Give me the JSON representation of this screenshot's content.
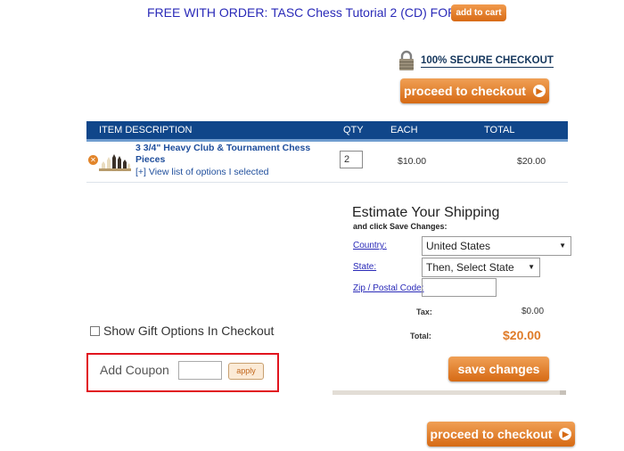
{
  "promo": {
    "text": "FREE WITH ORDER: TASC Chess Tutorial 2 (CD) FOR PC",
    "button": "add to cart"
  },
  "secure": {
    "label": "100% SECURE CHECKOUT",
    "icon": "padlock-icon"
  },
  "checkout": {
    "label": "proceed to checkout"
  },
  "table": {
    "headers": [
      "ITEM DESCRIPTION",
      "QTY",
      "EACH",
      "TOTAL"
    ],
    "items": [
      {
        "name": "3 3/4\" Heavy Club & Tournament Chess Pieces",
        "options_link": "[+] View list of options I selected",
        "qty": "2",
        "each": "$10.00",
        "total": "$20.00"
      }
    ]
  },
  "shipping": {
    "title": "Estimate Your Shipping",
    "subtitle": "and click Save Changes:",
    "country_label": "Country:",
    "country_value": "United States",
    "state_label": "State:",
    "state_value": "Then, Select State",
    "zip_label": "Zip / Postal Code:",
    "zip_value": ""
  },
  "summary": {
    "tax_label": "Tax:",
    "tax_value": "$0.00",
    "total_label": "Total:",
    "total_value": "$20.00"
  },
  "save_button": "save changes",
  "gift": {
    "label": "Show Gift Options In Checkout",
    "checked": false
  },
  "coupon": {
    "label": "Add Coupon",
    "value": "",
    "button": "apply"
  },
  "colors": {
    "accent": "#e0781f",
    "header_bg": "#10468a",
    "link": "#1f4e9c",
    "highlight": "#e1141e"
  }
}
